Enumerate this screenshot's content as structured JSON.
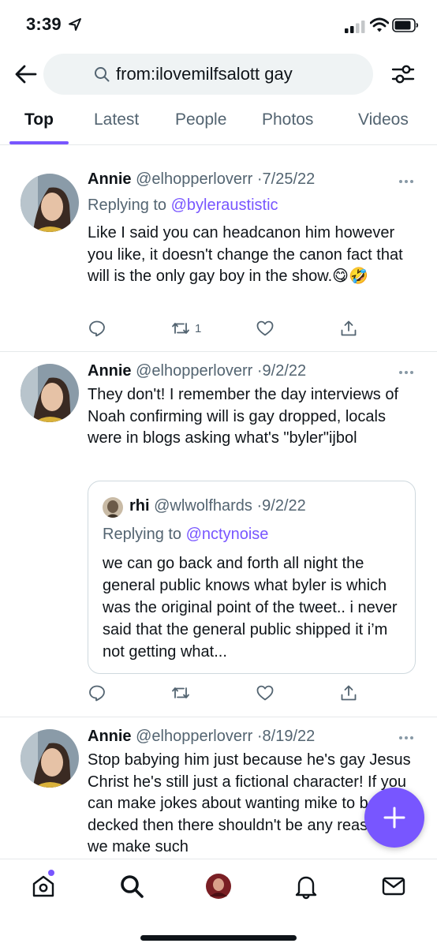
{
  "status_bar": {
    "time": "3:39"
  },
  "search": {
    "query": "from:ilovemilfsalott gay"
  },
  "tabs": [
    {
      "label": "Top",
      "active": true
    },
    {
      "label": "Latest"
    },
    {
      "label": "People"
    },
    {
      "label": "Photos"
    },
    {
      "label": "Videos"
    }
  ],
  "tweets": [
    {
      "name": "Annie",
      "handle": "@elhopperloverr",
      "date": "7/25/22",
      "replying_prefix": "Replying to",
      "replying_to": "@byleraustistic",
      "text": "Like I said you can headcanon him however you like, it doesn't change the canon fact that will is the only gay boy in the show.😋🤣",
      "retweets": "1"
    },
    {
      "name": "Annie",
      "handle": "@elhopperloverr",
      "date": "9/2/22",
      "text": "They don't! I remember the day interviews of Noah confirming will is gay dropped, locals were in blogs asking what's \"byler\"ijbol",
      "quote": {
        "name": "rhi",
        "handle": "@wlwolfhards",
        "date": "9/2/22",
        "replying_prefix": "Replying to",
        "replying_to": "@nctynoise",
        "text": "we can go back and forth all night the general public knows what byler is which was the original point of the tweet.. i never said that the general public shipped it i’m not getting what..."
      }
    },
    {
      "name": "Annie",
      "handle": "@elhopperloverr",
      "date": "8/19/22",
      "text": "Stop babying him just because he's gay Jesus Christ he's still just a fictional character! If you can make jokes about wanting mike to be decked then there shouldn't be any reason if we make such"
    }
  ],
  "colors": {
    "accent": "#7856ff",
    "text": "#0f1419",
    "secondary": "#536471"
  }
}
